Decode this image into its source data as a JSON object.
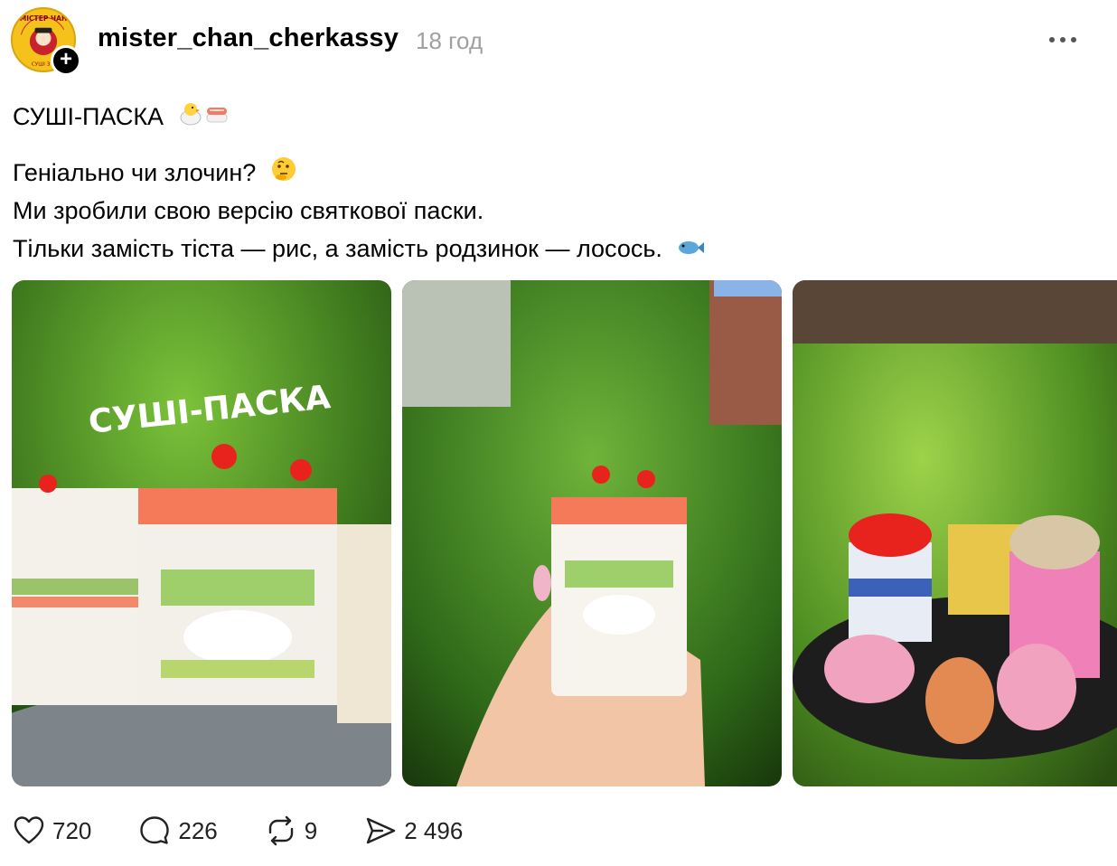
{
  "post": {
    "username": "mister_chan_cherkassy",
    "timestamp": "18 год",
    "avatar_text": "МІСТЕР ЧАН",
    "avatar_subtext": "СУШІ З С"
  },
  "caption": {
    "title": "СУШІ-ПАСКА",
    "line1": "Геніально чи злочин?",
    "line2": "Ми зробили свою версію святкової паски.",
    "line3": "Тільки замість тіста — рис, а замість родзинок — лосось."
  },
  "media": {
    "image1_overlay_text": "СУШІ-ПАСКА"
  },
  "actions": {
    "likes": "720",
    "comments": "226",
    "reposts": "9",
    "shares": "2 496"
  },
  "icons": {
    "like": "heart-icon",
    "comment": "comment-icon",
    "repost": "repost-icon",
    "share": "share-icon",
    "more": "more-icon"
  },
  "colors": {
    "secondary_text": "#a0a0a0",
    "avatar_bg": "#f5c21b"
  }
}
